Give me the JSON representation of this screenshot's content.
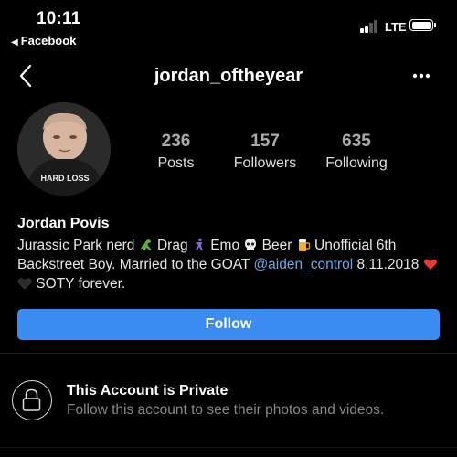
{
  "status_bar": {
    "time": "10:11",
    "back_app": "Facebook",
    "network": "LTE"
  },
  "nav": {
    "title": "jordan_oftheyear"
  },
  "profile": {
    "avatar_shirt_text": "HARD LOSS",
    "posts_count": "236",
    "posts_label": "Posts",
    "followers_count": "157",
    "followers_label": "Followers",
    "following_count": "635",
    "following_label": "Following",
    "name": "Jordan Povis",
    "bio": {
      "text1": "Jurassic Park nerd ",
      "text2": " Drag ",
      "text3": " Emo ",
      "text4": " Beer ",
      "text5": " Unofficial 6th Backstreet Boy. Married to the GOAT ",
      "mention": "@aiden_control",
      "text6": " 8.11.2018 ",
      "text7": " SOTY forever."
    }
  },
  "follow_button": "Follow",
  "private": {
    "title": "This Account is Private",
    "subtitle": "Follow this account to see their photos and videos."
  },
  "colors": {
    "follow": "#3b8cf0",
    "mention": "#6ea7e6",
    "background": "#000000"
  }
}
